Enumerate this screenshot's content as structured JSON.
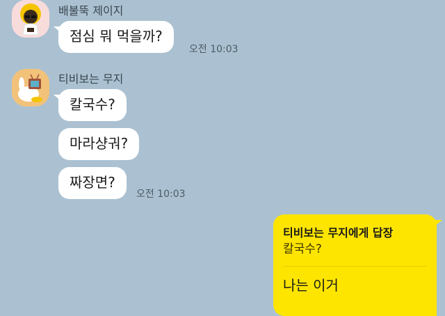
{
  "conversation": [
    {
      "sender": "배불뚝 제이지",
      "avatar_icon": "jay-g-avatar-icon",
      "messages": [
        "점심 뭐 먹을까?"
      ],
      "time": "오전 10:03"
    },
    {
      "sender": "티비보는 무지",
      "avatar_icon": "muzi-tv-avatar-icon",
      "messages": [
        "칼국수?",
        "마라샹궈?",
        "짜장면?"
      ],
      "time": "오전 10:03"
    }
  ],
  "my_reply": {
    "reply_to_label": "티비보는 무지에게 답장",
    "quoted_message": "칼국수?",
    "text": "나는 이거"
  },
  "colors": {
    "background": "#abc1d1",
    "incoming_bubble": "#ffffff",
    "outgoing_bubble": "#fee500"
  }
}
